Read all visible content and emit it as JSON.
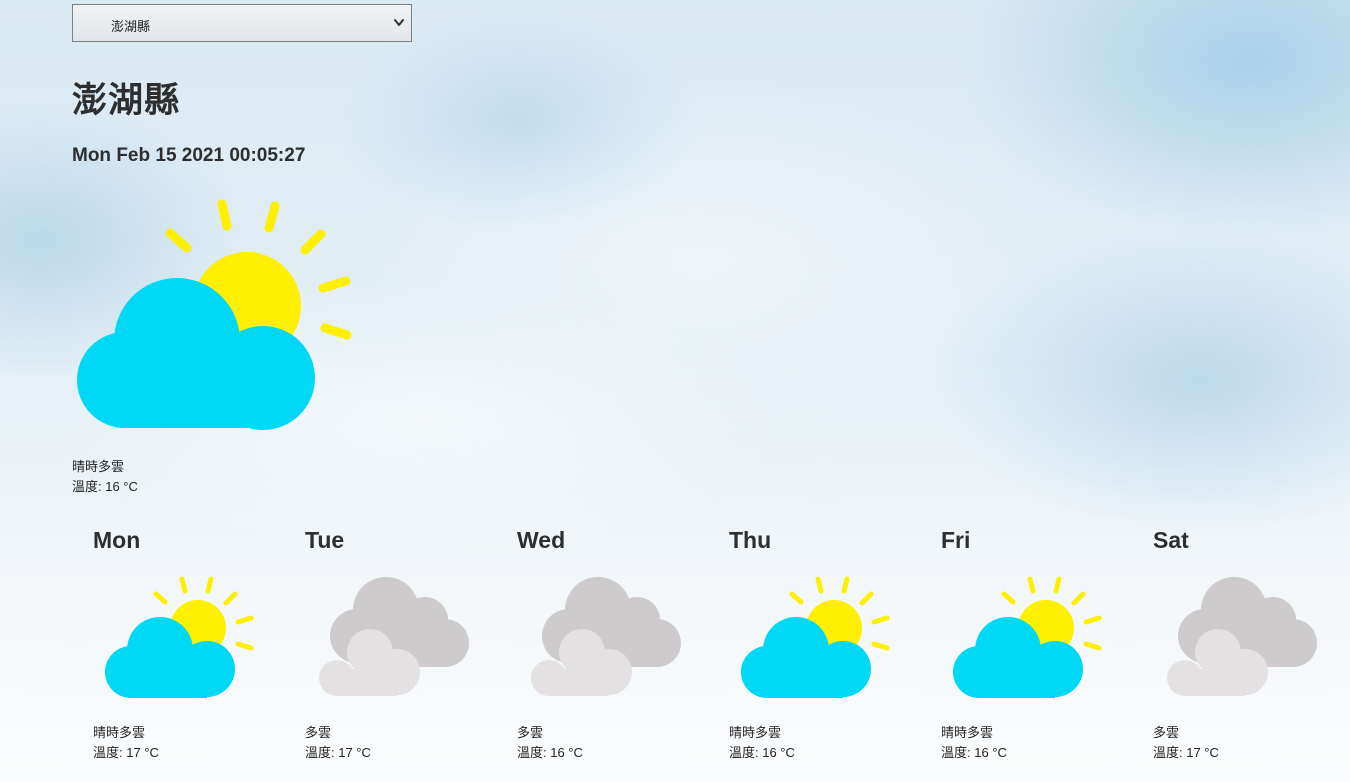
{
  "city_select": {
    "selected": "澎湖縣"
  },
  "header": {
    "city": "澎湖縣",
    "datetime": "Mon Feb 15 2021 00:05:27"
  },
  "current": {
    "icon": "partly-cloudy-icon",
    "description": "晴時多雲",
    "temperature": "溫度: 16 °C"
  },
  "forecast": [
    {
      "day": "Mon",
      "icon": "partly-cloudy-icon",
      "description": "晴時多雲",
      "temperature": "溫度: 17 °C"
    },
    {
      "day": "Tue",
      "icon": "cloudy-icon",
      "description": "多雲",
      "temperature": "溫度: 17 °C"
    },
    {
      "day": "Wed",
      "icon": "cloudy-icon",
      "description": "多雲",
      "temperature": "溫度: 16 °C"
    },
    {
      "day": "Thu",
      "icon": "partly-cloudy-icon",
      "description": "晴時多雲",
      "temperature": "溫度: 16 °C"
    },
    {
      "day": "Fri",
      "icon": "partly-cloudy-icon",
      "description": "晴時多雲",
      "temperature": "溫度: 16 °C"
    },
    {
      "day": "Sat",
      "icon": "cloudy-icon",
      "description": "多雲",
      "temperature": "溫度: 17 °C"
    }
  ],
  "colors": {
    "sun": "#ffef00",
    "cloud_blue": "#00d8f5",
    "cloud_gray_dark": "#cdcbcc",
    "cloud_gray_light": "#e3e1e2"
  }
}
